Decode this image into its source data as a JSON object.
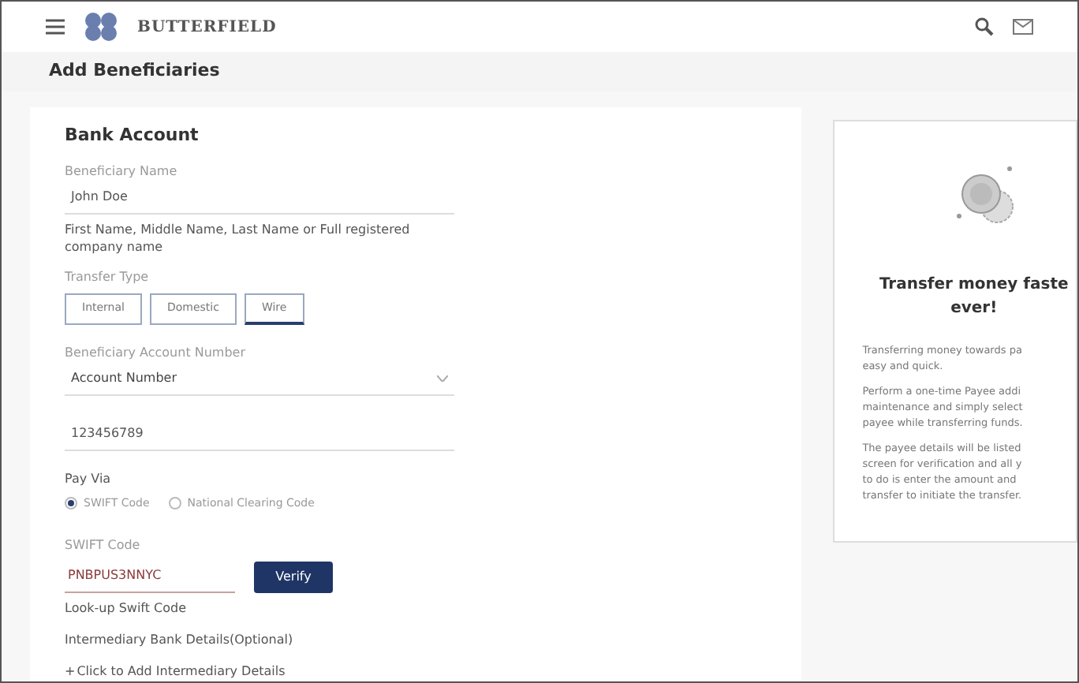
{
  "header": {
    "brand": "BUTTERFIELD"
  },
  "page_title": "Add Beneficiaries",
  "form": {
    "heading": "Bank Account",
    "beneficiary_name": {
      "label": "Beneficiary Name",
      "value": "John Doe",
      "hint": "First Name, Middle Name, Last Name or Full registered company name"
    },
    "transfer_type": {
      "label": "Transfer Type",
      "options": [
        {
          "label": "Internal",
          "selected": false
        },
        {
          "label": "Domestic",
          "selected": false
        },
        {
          "label": "Wire",
          "selected": true
        }
      ]
    },
    "account": {
      "label": "Beneficiary Account Number",
      "dropdown": "Account Number",
      "value": "123456789"
    },
    "pay_via": {
      "label": "Pay Via",
      "options": [
        {
          "label": "SWIFT Code",
          "selected": true
        },
        {
          "label": "National Clearing Code",
          "selected": false
        }
      ]
    },
    "swift": {
      "label": "SWIFT Code",
      "value": "PNBPUS3NNYC",
      "button": "Verify",
      "lookup": "Look-up Swift Code"
    },
    "intermediary": {
      "label": "Intermediary Bank Details(Optional)",
      "add_link": "Click to Add Intermediary Details",
      "add_icon": "+"
    }
  },
  "info_panel": {
    "title_lines": [
      "Transfer money faste",
      "ever!"
    ],
    "paragraphs": [
      [
        "Transferring money towards pa",
        "easy and quick."
      ],
      [
        "Perform a one-time Payee addi",
        "maintenance and simply select",
        "payee while transferring funds."
      ],
      [
        "The payee details will be listed",
        "screen for verification and all y",
        "to do is enter the amount and",
        "transfer to initiate the transfer."
      ]
    ]
  }
}
